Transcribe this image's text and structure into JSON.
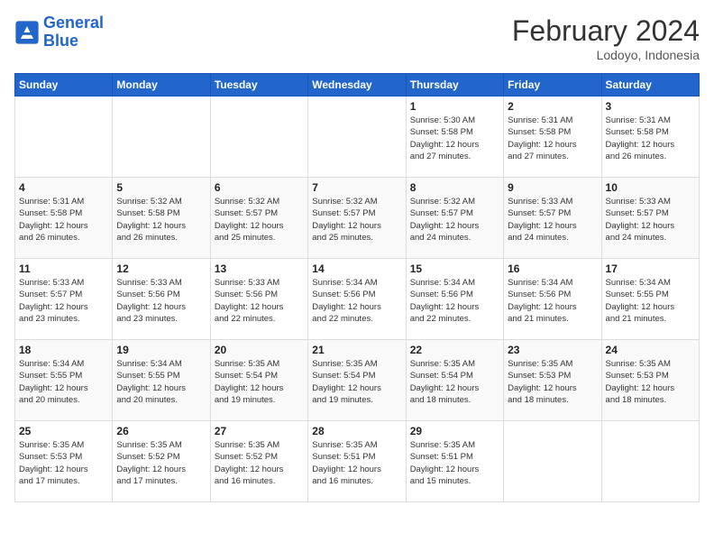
{
  "header": {
    "logo_line1": "General",
    "logo_line2": "Blue",
    "month_year": "February 2024",
    "location": "Lodoyo, Indonesia"
  },
  "weekdays": [
    "Sunday",
    "Monday",
    "Tuesday",
    "Wednesday",
    "Thursday",
    "Friday",
    "Saturday"
  ],
  "weeks": [
    [
      {
        "day": "",
        "info": ""
      },
      {
        "day": "",
        "info": ""
      },
      {
        "day": "",
        "info": ""
      },
      {
        "day": "",
        "info": ""
      },
      {
        "day": "1",
        "info": "Sunrise: 5:30 AM\nSunset: 5:58 PM\nDaylight: 12 hours\nand 27 minutes."
      },
      {
        "day": "2",
        "info": "Sunrise: 5:31 AM\nSunset: 5:58 PM\nDaylight: 12 hours\nand 27 minutes."
      },
      {
        "day": "3",
        "info": "Sunrise: 5:31 AM\nSunset: 5:58 PM\nDaylight: 12 hours\nand 26 minutes."
      }
    ],
    [
      {
        "day": "4",
        "info": "Sunrise: 5:31 AM\nSunset: 5:58 PM\nDaylight: 12 hours\nand 26 minutes."
      },
      {
        "day": "5",
        "info": "Sunrise: 5:32 AM\nSunset: 5:58 PM\nDaylight: 12 hours\nand 26 minutes."
      },
      {
        "day": "6",
        "info": "Sunrise: 5:32 AM\nSunset: 5:57 PM\nDaylight: 12 hours\nand 25 minutes."
      },
      {
        "day": "7",
        "info": "Sunrise: 5:32 AM\nSunset: 5:57 PM\nDaylight: 12 hours\nand 25 minutes."
      },
      {
        "day": "8",
        "info": "Sunrise: 5:32 AM\nSunset: 5:57 PM\nDaylight: 12 hours\nand 24 minutes."
      },
      {
        "day": "9",
        "info": "Sunrise: 5:33 AM\nSunset: 5:57 PM\nDaylight: 12 hours\nand 24 minutes."
      },
      {
        "day": "10",
        "info": "Sunrise: 5:33 AM\nSunset: 5:57 PM\nDaylight: 12 hours\nand 24 minutes."
      }
    ],
    [
      {
        "day": "11",
        "info": "Sunrise: 5:33 AM\nSunset: 5:57 PM\nDaylight: 12 hours\nand 23 minutes."
      },
      {
        "day": "12",
        "info": "Sunrise: 5:33 AM\nSunset: 5:56 PM\nDaylight: 12 hours\nand 23 minutes."
      },
      {
        "day": "13",
        "info": "Sunrise: 5:33 AM\nSunset: 5:56 PM\nDaylight: 12 hours\nand 22 minutes."
      },
      {
        "day": "14",
        "info": "Sunrise: 5:34 AM\nSunset: 5:56 PM\nDaylight: 12 hours\nand 22 minutes."
      },
      {
        "day": "15",
        "info": "Sunrise: 5:34 AM\nSunset: 5:56 PM\nDaylight: 12 hours\nand 22 minutes."
      },
      {
        "day": "16",
        "info": "Sunrise: 5:34 AM\nSunset: 5:56 PM\nDaylight: 12 hours\nand 21 minutes."
      },
      {
        "day": "17",
        "info": "Sunrise: 5:34 AM\nSunset: 5:55 PM\nDaylight: 12 hours\nand 21 minutes."
      }
    ],
    [
      {
        "day": "18",
        "info": "Sunrise: 5:34 AM\nSunset: 5:55 PM\nDaylight: 12 hours\nand 20 minutes."
      },
      {
        "day": "19",
        "info": "Sunrise: 5:34 AM\nSunset: 5:55 PM\nDaylight: 12 hours\nand 20 minutes."
      },
      {
        "day": "20",
        "info": "Sunrise: 5:35 AM\nSunset: 5:54 PM\nDaylight: 12 hours\nand 19 minutes."
      },
      {
        "day": "21",
        "info": "Sunrise: 5:35 AM\nSunset: 5:54 PM\nDaylight: 12 hours\nand 19 minutes."
      },
      {
        "day": "22",
        "info": "Sunrise: 5:35 AM\nSunset: 5:54 PM\nDaylight: 12 hours\nand 18 minutes."
      },
      {
        "day": "23",
        "info": "Sunrise: 5:35 AM\nSunset: 5:53 PM\nDaylight: 12 hours\nand 18 minutes."
      },
      {
        "day": "24",
        "info": "Sunrise: 5:35 AM\nSunset: 5:53 PM\nDaylight: 12 hours\nand 18 minutes."
      }
    ],
    [
      {
        "day": "25",
        "info": "Sunrise: 5:35 AM\nSunset: 5:53 PM\nDaylight: 12 hours\nand 17 minutes."
      },
      {
        "day": "26",
        "info": "Sunrise: 5:35 AM\nSunset: 5:52 PM\nDaylight: 12 hours\nand 17 minutes."
      },
      {
        "day": "27",
        "info": "Sunrise: 5:35 AM\nSunset: 5:52 PM\nDaylight: 12 hours\nand 16 minutes."
      },
      {
        "day": "28",
        "info": "Sunrise: 5:35 AM\nSunset: 5:51 PM\nDaylight: 12 hours\nand 16 minutes."
      },
      {
        "day": "29",
        "info": "Sunrise: 5:35 AM\nSunset: 5:51 PM\nDaylight: 12 hours\nand 15 minutes."
      },
      {
        "day": "",
        "info": ""
      },
      {
        "day": "",
        "info": ""
      }
    ]
  ]
}
